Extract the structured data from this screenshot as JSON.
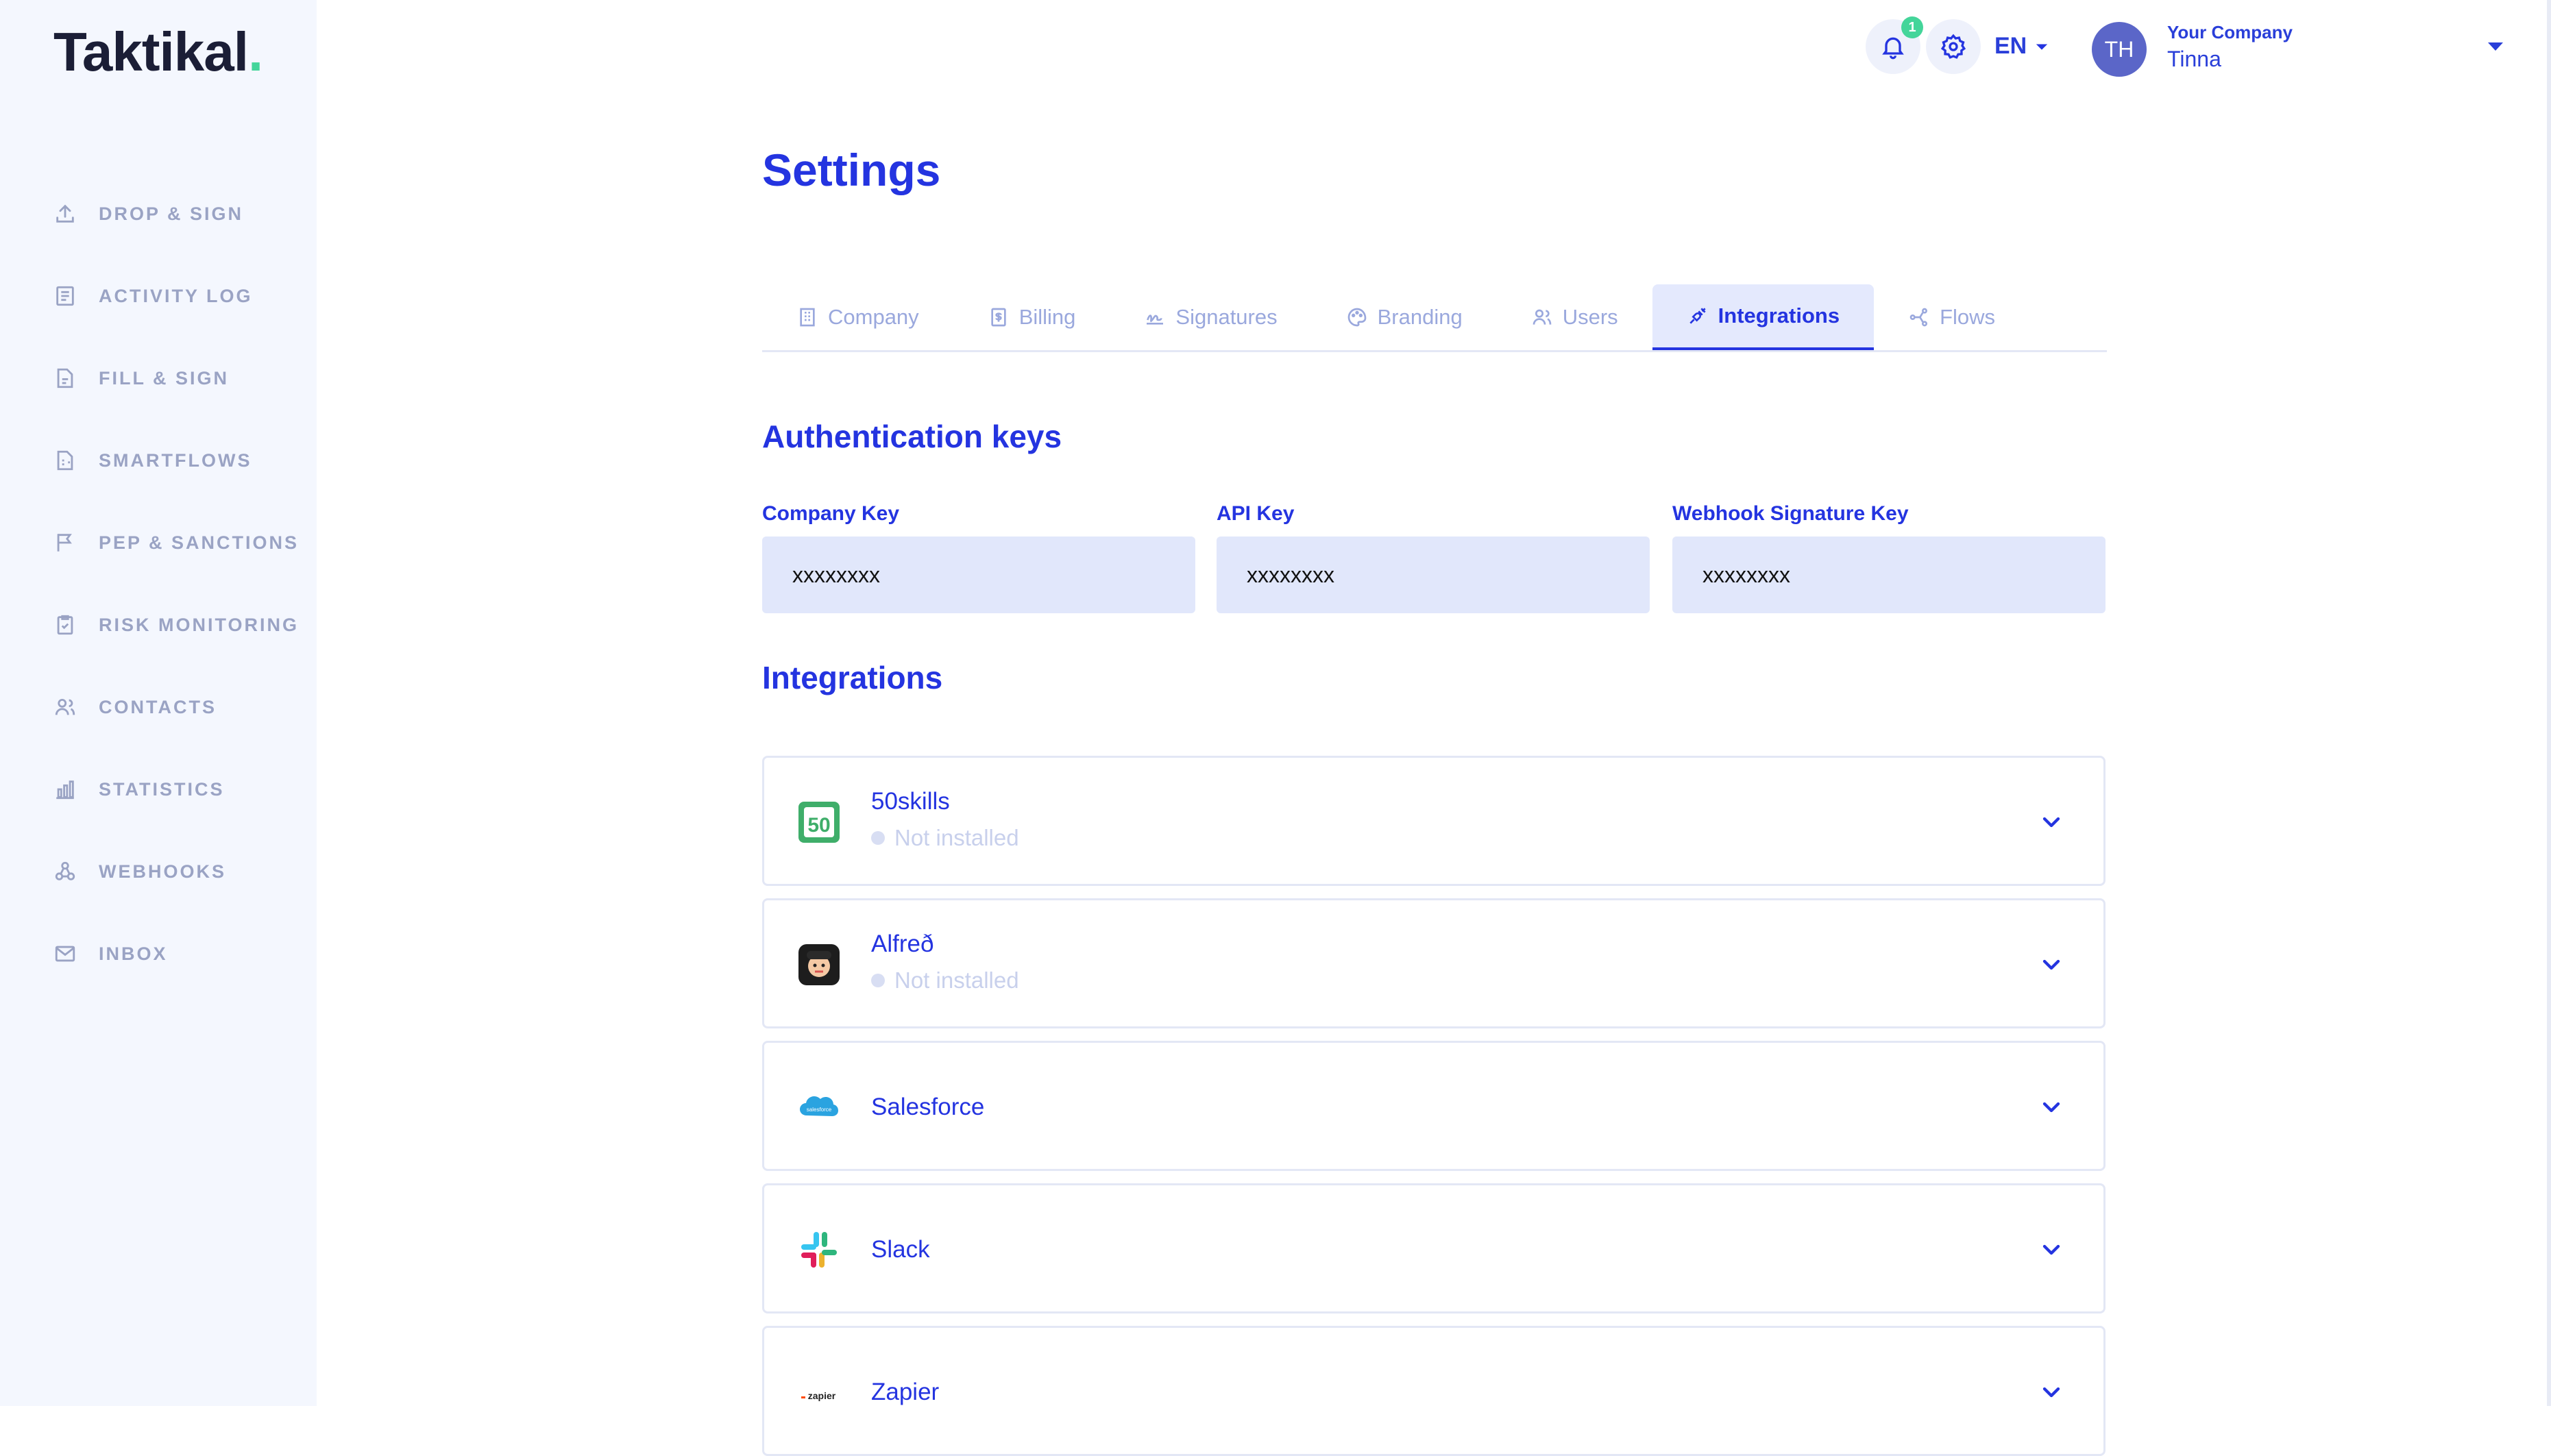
{
  "brand": {
    "name": "Taktikal",
    "dot": ".",
    "accent": "#44d59a"
  },
  "sidebar": {
    "items": [
      {
        "label": "DROP & SIGN",
        "icon": "upload-icon"
      },
      {
        "label": "ACTIVITY LOG",
        "icon": "list-icon"
      },
      {
        "label": "FILL & SIGN",
        "icon": "document-edit-icon"
      },
      {
        "label": "SMARTFLOWS",
        "icon": "document-flow-icon"
      },
      {
        "label": "PEP & SANCTIONS",
        "icon": "flag-icon"
      },
      {
        "label": "RISK MONITORING",
        "icon": "clipboard-check-icon"
      },
      {
        "label": "CONTACTS",
        "icon": "users-icon"
      },
      {
        "label": "STATISTICS",
        "icon": "bar-chart-icon"
      },
      {
        "label": "WEBHOOKS",
        "icon": "webhook-icon"
      },
      {
        "label": "INBOX",
        "icon": "mail-icon"
      }
    ]
  },
  "header": {
    "notifications_count": "1",
    "language": "EN",
    "avatar_initials": "TH",
    "company": "Your Company",
    "user_name": "Tinna"
  },
  "page": {
    "title": "Settings"
  },
  "tabs": [
    {
      "label": "Company",
      "icon": "building-icon",
      "active": false
    },
    {
      "label": "Billing",
      "icon": "invoice-icon",
      "active": false
    },
    {
      "label": "Signatures",
      "icon": "signature-icon",
      "active": false
    },
    {
      "label": "Branding",
      "icon": "palette-icon",
      "active": false
    },
    {
      "label": "Users",
      "icon": "users-icon",
      "active": false
    },
    {
      "label": "Integrations",
      "icon": "plug-icon",
      "active": true
    },
    {
      "label": "Flows",
      "icon": "share-icon",
      "active": false
    }
  ],
  "auth_keys": {
    "title": "Authentication keys",
    "fields": [
      {
        "label": "Company Key",
        "value": "xxxxxxxx"
      },
      {
        "label": "API Key",
        "value": "xxxxxxxx"
      },
      {
        "label": "Webhook Signature Key",
        "value": "xxxxxxxx"
      }
    ]
  },
  "integrations": {
    "title": "Integrations",
    "items": [
      {
        "name": "50skills",
        "status": "Not installed",
        "logo": "50skills-logo"
      },
      {
        "name": "Alfreð",
        "status": "Not installed",
        "logo": "alfred-logo"
      },
      {
        "name": "Salesforce",
        "status": "",
        "logo": "salesforce-logo"
      },
      {
        "name": "Slack",
        "status": "",
        "logo": "slack-logo"
      },
      {
        "name": "Zapier",
        "status": "",
        "logo": "zapier-logo"
      }
    ]
  },
  "colors": {
    "primary": "#2434e0",
    "sidebar_bg": "#f4f7fe",
    "muted_nav": "#9aa3c4",
    "input_bg": "#e1e7fb",
    "badge_green": "#44d59a"
  }
}
